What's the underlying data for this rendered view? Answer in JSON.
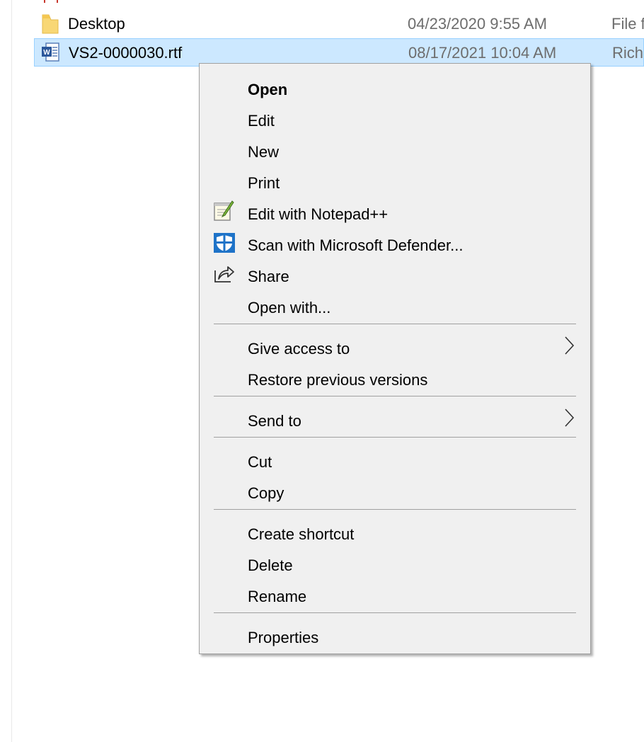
{
  "files": [
    {
      "name": "",
      "date": "",
      "type": "",
      "icon": "pdf-icon"
    },
    {
      "name": "Desktop",
      "date": "04/23/2020 9:55 AM",
      "type": "File f",
      "icon": "folder-icon"
    },
    {
      "name": "VS2-0000030.rtf",
      "date": "08/17/2021 10:04 AM",
      "type": "Rich",
      "icon": "word-document-icon",
      "selected": true
    }
  ],
  "context_menu": {
    "items": {
      "open": "Open",
      "edit": "Edit",
      "new": "New",
      "print": "Print",
      "edit_notepad": "Edit with Notepad++",
      "scan_defender": "Scan with Microsoft Defender...",
      "share": "Share",
      "open_with": "Open with...",
      "give_access": "Give access to",
      "restore_versions": "Restore previous versions",
      "send_to": "Send to",
      "cut": "Cut",
      "copy": "Copy",
      "create_shortcut": "Create shortcut",
      "delete": "Delete",
      "rename": "Rename",
      "properties": "Properties"
    },
    "icons": {
      "edit_notepad": "notepad-plus-plus-icon",
      "scan_defender": "defender-shield-icon",
      "share": "share-icon",
      "submenu": "chevron-right-icon"
    }
  },
  "colors": {
    "selection_bg": "#cce8ff",
    "selection_border": "#99d1ff",
    "menu_bg": "#f0f0f0",
    "menu_border": "#a0a0a0",
    "secondary_text": "#6d6d6d",
    "defender_blue": "#1e73c8",
    "folder_yellow": "#f8d775"
  }
}
